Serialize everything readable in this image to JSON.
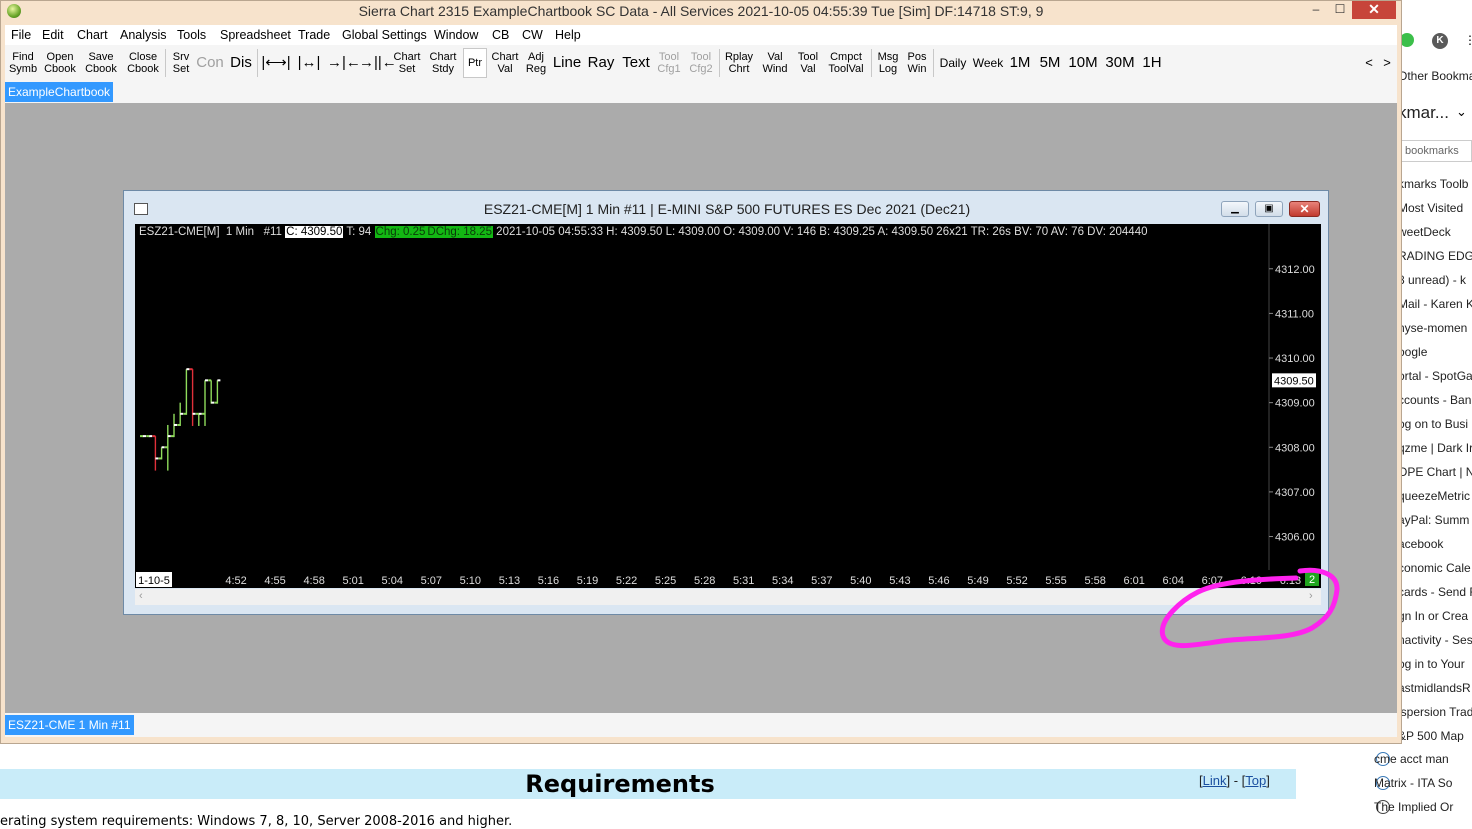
{
  "browser": {
    "top_avatar_letter": "K",
    "bookmarks_panel_title": "kmar...",
    "bookmarks_link": "bookmarks",
    "other_bookmarks": "Other Bookmarks",
    "items": [
      "kmarks Toolb",
      "Most Visited",
      "weetDeck",
      "RADING EDGE",
      "8 unread) - k",
      "Mail - Karen Ka",
      "nyse-momen",
      "oogle",
      "ortal - SpotGa",
      "ccounts - Ban",
      "og on to Busi",
      "qzme | Dark Ir",
      "OPE Chart | N",
      "queezeMetric",
      "ayPal: Summ",
      "acebook",
      "conomic Cale",
      "cards - Send F",
      "gn In or Crea",
      "nactivity - Ses",
      "og in to Your",
      "astmidlandsR",
      "ispersion Trad",
      "&P 500 Map"
    ],
    "items_lower": [
      "cme acct man",
      "Matrix - ITA So",
      "The Implied Or"
    ],
    "page_heading": "Requirements",
    "link_label": "Link",
    "top_label": "Top",
    "body_text": "erating system requirements: Windows 7, 8, 10, Server 2008-2016 and higher."
  },
  "app": {
    "title": "Sierra Chart 2315 ExampleChartbook  SC Data - All Services 2021-10-05  04:55:39 Tue [Sim]  DF:14718  ST:9, 9",
    "minimize": "–",
    "maximize": "☐",
    "close": "✕",
    "menu": [
      "File",
      "Edit",
      "Chart",
      "Analysis",
      "Tools",
      "Spreadsheet",
      "Trade",
      "Global Settings",
      "Window",
      "CB",
      "CW",
      "Help"
    ],
    "toolbar": {
      "find": [
        "Find",
        "Symb"
      ],
      "open": [
        "Open",
        "Cbook"
      ],
      "save": [
        "Save",
        "Cbook"
      ],
      "close": [
        "Close",
        "Cbook"
      ],
      "srv": [
        "Srv",
        "Set"
      ],
      "con": "Con",
      "dis": "Dis",
      "chart_set": [
        "Chart",
        "Set"
      ],
      "chart_stdy": [
        "Chart",
        "Stdy"
      ],
      "ptr": "Ptr",
      "chart_val": [
        "Chart",
        "Val"
      ],
      "adj_reg": [
        "Adj",
        "Reg"
      ],
      "line": "Line",
      "ray": "Ray",
      "text": "Text",
      "tool_cfg1": [
        "Tool",
        "Cfg1"
      ],
      "tool_cfg2": [
        "Tool",
        "Cfg2"
      ],
      "rplay": [
        "Rplay",
        "Chrt"
      ],
      "val_wind": [
        "Val",
        "Wind"
      ],
      "tool_val": [
        "Tool",
        "Val"
      ],
      "cmpct": [
        "Cmpct",
        "ToolVal"
      ],
      "msg_log": [
        "Msg",
        "Log"
      ],
      "pos_win": [
        "Pos",
        "Win"
      ],
      "daily": "Daily",
      "week": "Week",
      "m1": "1M",
      "m5": "5M",
      "m10": "10M",
      "m30": "30M",
      "h1": "1H",
      "prev": "<",
      "next": ">"
    },
    "chartbook_tab": "ExampleChartbook",
    "bottom_tab": "ESZ21-CME  1 Min  #11"
  },
  "chart": {
    "window_title": "ESZ21-CME[M]  1 Min   #11 | E-MINI S&P 500 FUTURES ES Dec 2021 (Dec21)",
    "header": {
      "symbol": "ESZ21-CME[M]  1 Min   #11 ",
      "close": "C: 4309.50",
      "trades": " T: 94 ",
      "chg": "Chg: 0.25",
      "dchg": "DChg: 18.25",
      "rest": " 2021-10-05 04:55:33 H: 4309.50 L: 4309.00 O: 4309.00 V: 146 B: 4309.25 A: 4309.50 26x21 TR: 26s BV: 70 AV: 76 DV: 204440"
    },
    "current_price_label": "4309.50",
    "bottom_right_marker": "2",
    "colors": {
      "up": "#8fdc5c",
      "down": "#e0303a",
      "close_tick": "#ffffff",
      "background": "#000000",
      "highlight": "#ff22ee"
    }
  },
  "chart_data": {
    "type": "ohlc",
    "title": "ESZ21-CME[M]  1 Min   #11 | E-MINI S&P 500 FUTURES ES Dec 2021 (Dec21)",
    "xlabel": "",
    "ylabel": "",
    "y_ticks": [
      4306,
      4307,
      4308,
      4309,
      4310,
      4311,
      4312
    ],
    "y_tick_labels": [
      "4306.00",
      "4307.00",
      "4308.00",
      "4309.00",
      "4310.00",
      "4311.00",
      "4312.00"
    ],
    "ylim": [
      4305.25,
      4312.6
    ],
    "x_tick_labels": [
      "1-10-5",
      "4:52",
      "4:55",
      "4:58",
      "5:01",
      "5:04",
      "5:07",
      "5:10",
      "5:13",
      "5:16",
      "5:19",
      "5:22",
      "5:25",
      "5:28",
      "5:31",
      "5:34",
      "5:37",
      "5:40",
      "5:43",
      "5:46",
      "5:49",
      "5:52",
      "5:55",
      "5:58",
      "6:01",
      "6:04",
      "6:07",
      "6:10",
      "6:13"
    ],
    "bars": [
      {
        "o": 4308.25,
        "h": 4308.25,
        "l": 4308.25,
        "c": 4308.25,
        "dir": "up"
      },
      {
        "o": 4308.25,
        "h": 4308.25,
        "l": 4308.25,
        "c": 4308.25,
        "dir": "up"
      },
      {
        "o": 4308.25,
        "h": 4308.25,
        "l": 4307.5,
        "c": 4307.75,
        "dir": "down"
      },
      {
        "o": 4307.75,
        "h": 4308.0,
        "l": 4307.75,
        "c": 4308.0,
        "dir": "up"
      },
      {
        "o": 4308.0,
        "h": 4308.5,
        "l": 4307.5,
        "c": 4308.25,
        "dir": "up"
      },
      {
        "o": 4308.25,
        "h": 4308.75,
        "l": 4308.25,
        "c": 4308.5,
        "dir": "up"
      },
      {
        "o": 4308.5,
        "h": 4309.0,
        "l": 4308.5,
        "c": 4308.75,
        "dir": "up"
      },
      {
        "o": 4308.75,
        "h": 4309.75,
        "l": 4308.75,
        "c": 4309.75,
        "dir": "up"
      },
      {
        "o": 4309.75,
        "h": 4309.75,
        "l": 4308.5,
        "c": 4308.75,
        "dir": "down"
      },
      {
        "o": 4308.75,
        "h": 4308.75,
        "l": 4308.5,
        "c": 4308.75,
        "dir": "up"
      },
      {
        "o": 4308.75,
        "h": 4309.5,
        "l": 4308.5,
        "c": 4309.5,
        "dir": "up"
      },
      {
        "o": 4309.5,
        "h": 4309.5,
        "l": 4309.0,
        "c": 4309.0,
        "dir": "up"
      },
      {
        "o": 4309.0,
        "h": 4309.5,
        "l": 4309.0,
        "c": 4309.5,
        "dir": "up"
      }
    ]
  }
}
